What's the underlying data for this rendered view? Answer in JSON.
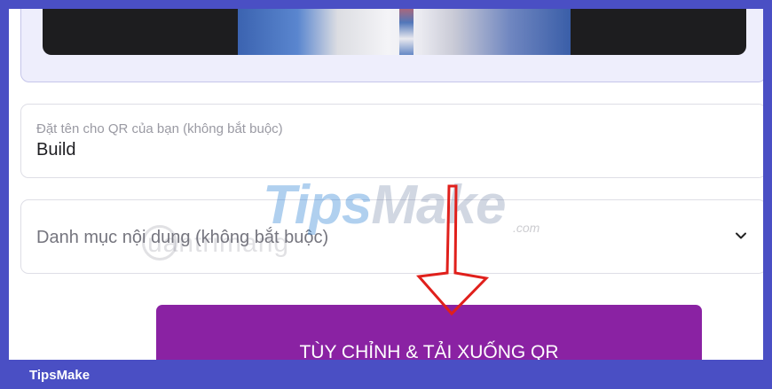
{
  "preview": {
    "image_icon": "qr-preview-photo"
  },
  "name_field": {
    "label": "Đặt tên cho QR của bạn (không bắt buộc)",
    "value": "Build"
  },
  "category_select": {
    "placeholder": "Danh mục nội dung (không bắt buộc)",
    "icon": "chevron-down-icon"
  },
  "customize_button": {
    "label": "TÙY CHỈNH & TẢI XUỐNG QR"
  },
  "watermark": {
    "part1": "Tips",
    "part2": "Make",
    "suffix": ".com",
    "secondary": "uantrimang"
  },
  "footer": {
    "brand": "TipsMake"
  },
  "colors": {
    "frame": "#4a4fc4",
    "button": "#8a22a3",
    "arrow": "#e0201c"
  }
}
